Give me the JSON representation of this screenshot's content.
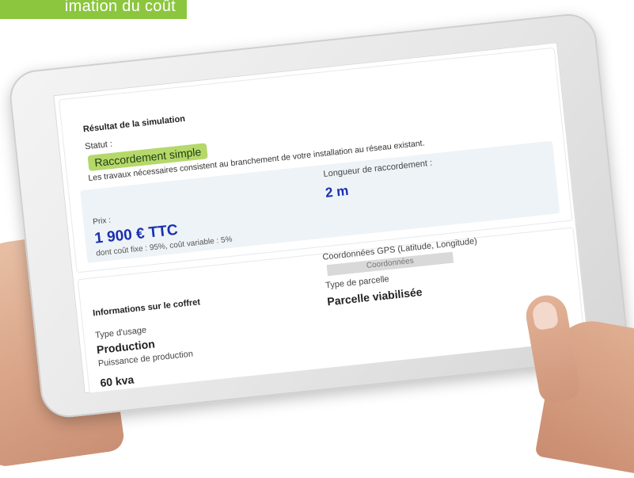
{
  "banner": {
    "text": "imation du coût"
  },
  "colors": {
    "accent_green": "#8cc63f",
    "badge_green": "#b5d86a",
    "price_blue": "#1a2fb0",
    "panel_bg": "#eef3f7"
  },
  "result": {
    "title": "Résultat de la simulation",
    "statut_label": "Statut :",
    "statut_badge": "Raccordement simple",
    "description": "Les travaux nécessaires consistent au branchement de votre installation au réseau existant.",
    "prix_label": "Prix :",
    "prix_value": "1 900 € TTC",
    "prix_detail": "dont coût fixe : 95%, coût variable : 5%",
    "longueur_label": "Longueur de raccordement :",
    "longueur_value": "2 m"
  },
  "coffret": {
    "title": "Informations sur le coffret",
    "usage_label": "Type d'usage",
    "usage_value": "Production",
    "puissance_label": "Puissance de production",
    "puissance_value": "60 kva",
    "gps_label": "Coordonnées GPS (Latitude, Longitude)",
    "gps_placeholder": "Coordonnées",
    "parcelle_label": "Type de parcelle",
    "parcelle_value": "Parcelle viabilisée"
  }
}
